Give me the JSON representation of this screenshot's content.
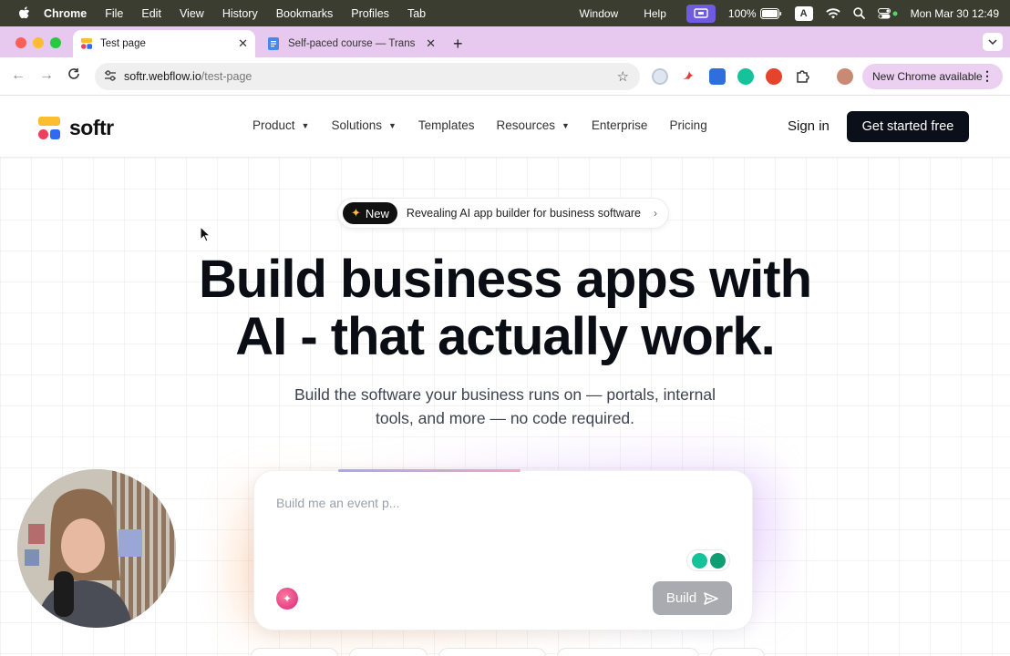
{
  "menubar": {
    "app": "Chrome",
    "items": [
      "File",
      "Edit",
      "View",
      "History",
      "Bookmarks",
      "Profiles",
      "Tab"
    ],
    "right_items": [
      "Window",
      "Help"
    ],
    "battery": "100%",
    "input_source": "A",
    "datetime": "Mon Mar 30  12:49"
  },
  "browser": {
    "tabs": [
      {
        "title": "Test page",
        "active": true
      },
      {
        "title": "Self-paced course — Transitio",
        "active": false
      }
    ],
    "url_host": "softr.webflow.io",
    "url_path": "/test-page",
    "update_label": "New Chrome available"
  },
  "site": {
    "logo": "softr",
    "nav": [
      {
        "label": "Product",
        "dropdown": true
      },
      {
        "label": "Solutions",
        "dropdown": true
      },
      {
        "label": "Templates",
        "dropdown": false
      },
      {
        "label": "Resources",
        "dropdown": true
      },
      {
        "label": "Enterprise",
        "dropdown": false
      },
      {
        "label": "Pricing",
        "dropdown": false
      }
    ],
    "signin": "Sign in",
    "cta": "Get started free",
    "announcement": {
      "tag": "New",
      "text": "Revealing AI app builder for business software"
    },
    "headline_1": "Build business apps with",
    "headline_2": "AI - that actually work.",
    "subline": "Build the software your business runs on — portals, internal tools, and more — no code required.",
    "prompt_placeholder": "Build me an event p...",
    "build_label": "Build"
  },
  "colors": {
    "brand_yellow": "#fcbd30",
    "brand_red": "#ee3f60",
    "brand_blue": "#2e6bf0",
    "cta_bg": "#0b0f1a",
    "tabbar_bg": "#e7c8ee"
  }
}
